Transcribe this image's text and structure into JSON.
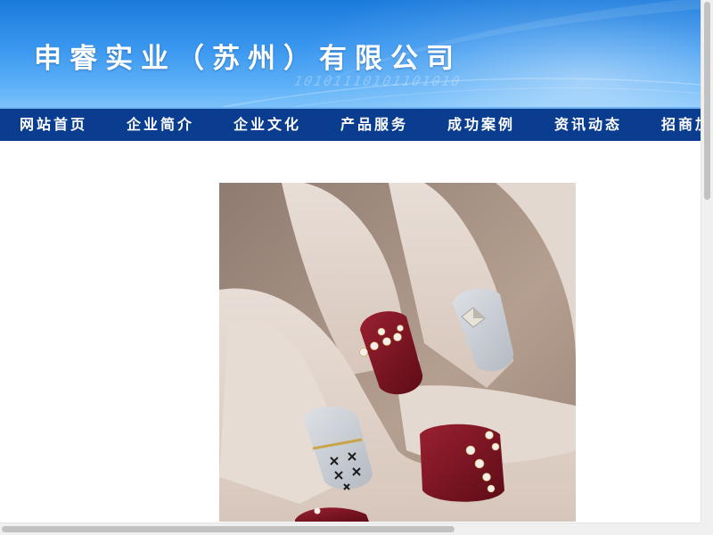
{
  "header": {
    "title": "申睿实业（苏州）有限公司",
    "binary_decoration": "10101110101101010"
  },
  "nav": {
    "items": [
      {
        "label": "网站首页"
      },
      {
        "label": "企业简介"
      },
      {
        "label": "企业文化"
      },
      {
        "label": "产品服务"
      },
      {
        "label": "成功案例"
      },
      {
        "label": "资讯动态"
      },
      {
        "label": "招商加盟"
      }
    ]
  },
  "content": {
    "image_subject": "nail-art-photo"
  },
  "colors": {
    "banner_blue": "#3a97ef",
    "nav_dark_blue": "#0a3d8f",
    "nail_burgundy": "#7e1420",
    "nail_grey": "#c8cdd4"
  }
}
